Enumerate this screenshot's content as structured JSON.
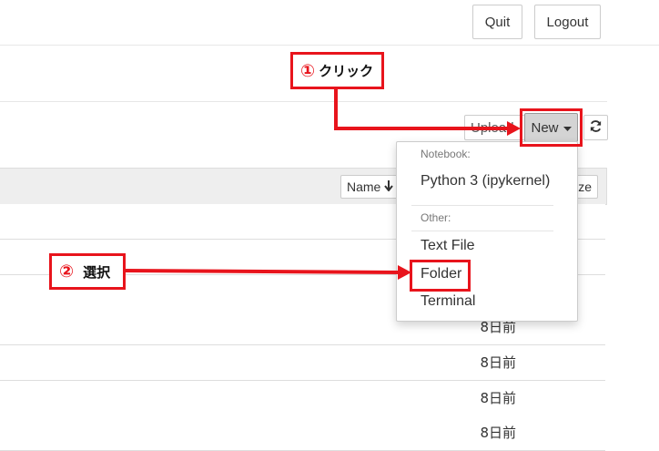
{
  "header": {
    "quit_label": "Quit",
    "logout_label": "Logout"
  },
  "toolbar": {
    "upload_label": "Upload",
    "new_label": "New",
    "refresh_icon": "refresh-icon"
  },
  "list_header": {
    "name_label": "Name",
    "sort_icon": "arrow-down-icon",
    "size_label": "Size"
  },
  "rows": [
    {
      "modified": ""
    },
    {
      "modified": ""
    },
    {
      "modified": ""
    },
    {
      "modified": "8日前"
    },
    {
      "modified": "8日前"
    },
    {
      "modified": "8日前"
    },
    {
      "modified": "8日前"
    }
  ],
  "dropdown": {
    "notebook_header": "Notebook:",
    "python_label": "Python 3 (ipykernel)",
    "other_header": "Other:",
    "textfile_label": "Text File",
    "folder_label": "Folder",
    "terminal_label": "Terminal"
  },
  "annotations": {
    "step1_number": "①",
    "step1_text": "クリック",
    "step2_number": "②",
    "step2_text": "選択",
    "color": "#e8141c"
  }
}
